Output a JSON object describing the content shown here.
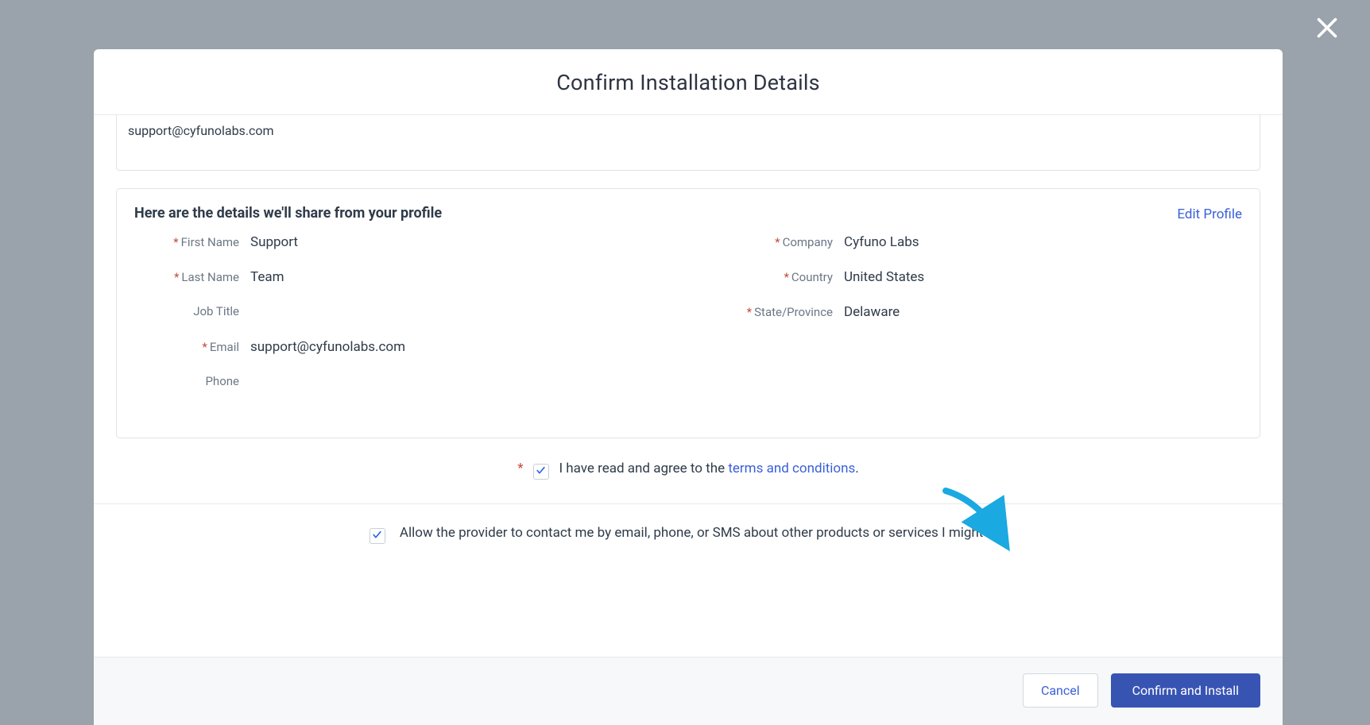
{
  "modal": {
    "title": "Confirm Installation Details",
    "email_preview": "support@cyfunolabs.com",
    "profile": {
      "heading": "Here are the details we'll share from your profile",
      "edit_link_label": "Edit Profile",
      "labels": {
        "first_name": "First Name",
        "last_name": "Last Name",
        "job_title": "Job Title",
        "email": "Email",
        "phone": "Phone",
        "company": "Company",
        "country": "Country",
        "state_province": "State/Province"
      },
      "values": {
        "first_name": "Support",
        "last_name": "Team",
        "job_title": "",
        "email": "support@cyfunolabs.com",
        "phone": "",
        "company": "Cyfuno Labs",
        "country": "United States",
        "state_province": "Delaware"
      }
    },
    "terms": {
      "prefix": "I have read and agree to the ",
      "link_text": "terms and conditions",
      "suffix": "."
    },
    "contact_consent": "Allow the provider to contact me by email, phone, or SMS about other products or services I might like",
    "buttons": {
      "cancel": "Cancel",
      "confirm": "Confirm and Install"
    }
  }
}
